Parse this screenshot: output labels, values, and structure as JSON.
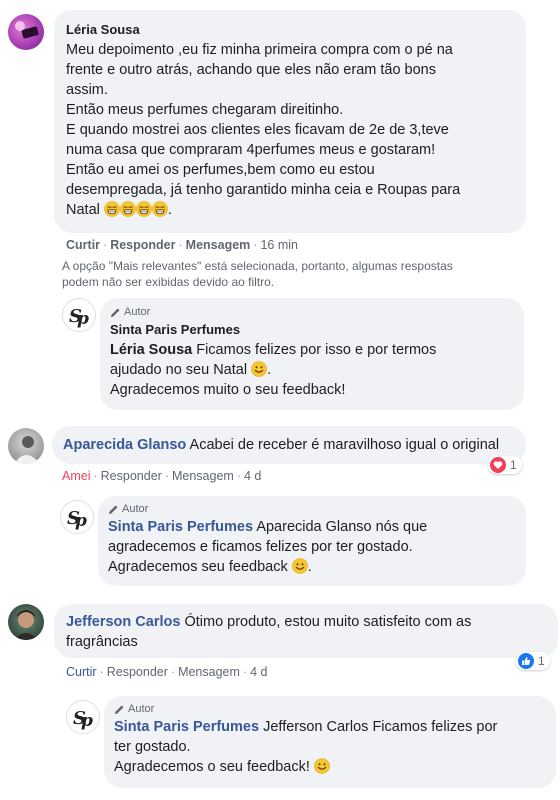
{
  "comment1": {
    "author": "Léria Sousa",
    "lines": [
      "Meu depoimento ,eu fiz minha primeira compra com o pé na",
      "frente e outro atrás, achando que eles não eram tão bons",
      "assim.",
      "Então meus perfumes chegaram direitinho.",
      "E quando mostrei aos clientes eles ficavam de 2e de 3,teve",
      "numa casa que compraram 4perfumes meus e gostaram!",
      "Então eu amei os perfumes,bem como eu estou",
      "desempregada, já tenho garantido minha ceia e Roupas para",
      "Natal"
    ],
    "actions": {
      "like": "Curtir",
      "reply": "Responder",
      "message": "Mensagem",
      "time": "16 min"
    },
    "notice": [
      "A opção \"Mais relevantes\" está selecionada, portanto, algumas respostas",
      "podem não ser exibidas devido ao filtro."
    ]
  },
  "reply1": {
    "badge": "Autor",
    "author": "Sinta Paris Perfumes",
    "mention": "Léria Sousa",
    "line1": " Ficamos felizes por isso e por termos",
    "line2": "ajudado no seu Natal",
    "line3": "Agradecemos muito o seu feedback!"
  },
  "comment2": {
    "author": "Aparecida Glanso",
    "text": " Acabei de receber é maravilhoso igual o original",
    "actions": {
      "like": "Amei",
      "reply": "Responder",
      "message": "Mensagem",
      "time": "4 d"
    },
    "reaction_count": "1",
    "reaction_color": "#f33e58"
  },
  "reply2": {
    "badge": "Autor",
    "author": "Sinta Paris Perfumes",
    "mention": "Aparecida Glanso",
    "line1": " nós que",
    "line2": "agradecemos e ficamos felizes por ter gostado.",
    "line3": "Agradecemos seu feedback"
  },
  "comment3": {
    "author": "Jefferson Carlos",
    "line1": " Ótimo produto, estou muito satisfeito com as",
    "line2": "fragrâncias",
    "actions": {
      "like": "Curtir",
      "reply": "Responder",
      "message": "Mensagem",
      "time": "4 d"
    },
    "reaction_count": "1",
    "reaction_color": "#1877f2"
  },
  "reply3": {
    "badge": "Autor",
    "author": "Sinta Paris Perfumes",
    "mention": "Jefferson Carlos",
    "line1": " Ficamos felizes por",
    "line2": "ter gostado.",
    "line3": "Agradecemos o seu feedback!"
  },
  "icons": {
    "smile": "smile-emoji",
    "grin": "grin-emoji",
    "pencil": "pencil-icon",
    "heart": "heart-reaction",
    "like": "like-reaction"
  },
  "colors": {
    "name": "#385898",
    "bubble": "#f0f2f5",
    "love": "#f33e58",
    "like": "#1877f2"
  }
}
